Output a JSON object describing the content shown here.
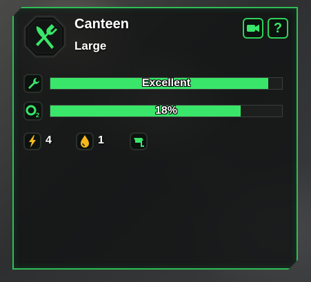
{
  "building": {
    "name": "Canteen",
    "size": "Large"
  },
  "buttons": {
    "camera_icon": "video-camera-icon",
    "help_label": "?"
  },
  "condition": {
    "icon": "wrench-icon",
    "label": "Excellent",
    "fill_fraction": 0.94
  },
  "oxygen": {
    "icon": "o2-icon",
    "label": "18%",
    "fill_fraction": 0.82
  },
  "stats": {
    "power": {
      "icon": "lightning-bolt-icon",
      "value": "4"
    },
    "water": {
      "icon": "water-drop-icon",
      "value": "1"
    },
    "camera": {
      "icon": "security-camera-icon"
    }
  },
  "colors": {
    "accent": "#2fbf55",
    "bar_fill": "#3ae66a",
    "panel_bg": "#121413"
  }
}
